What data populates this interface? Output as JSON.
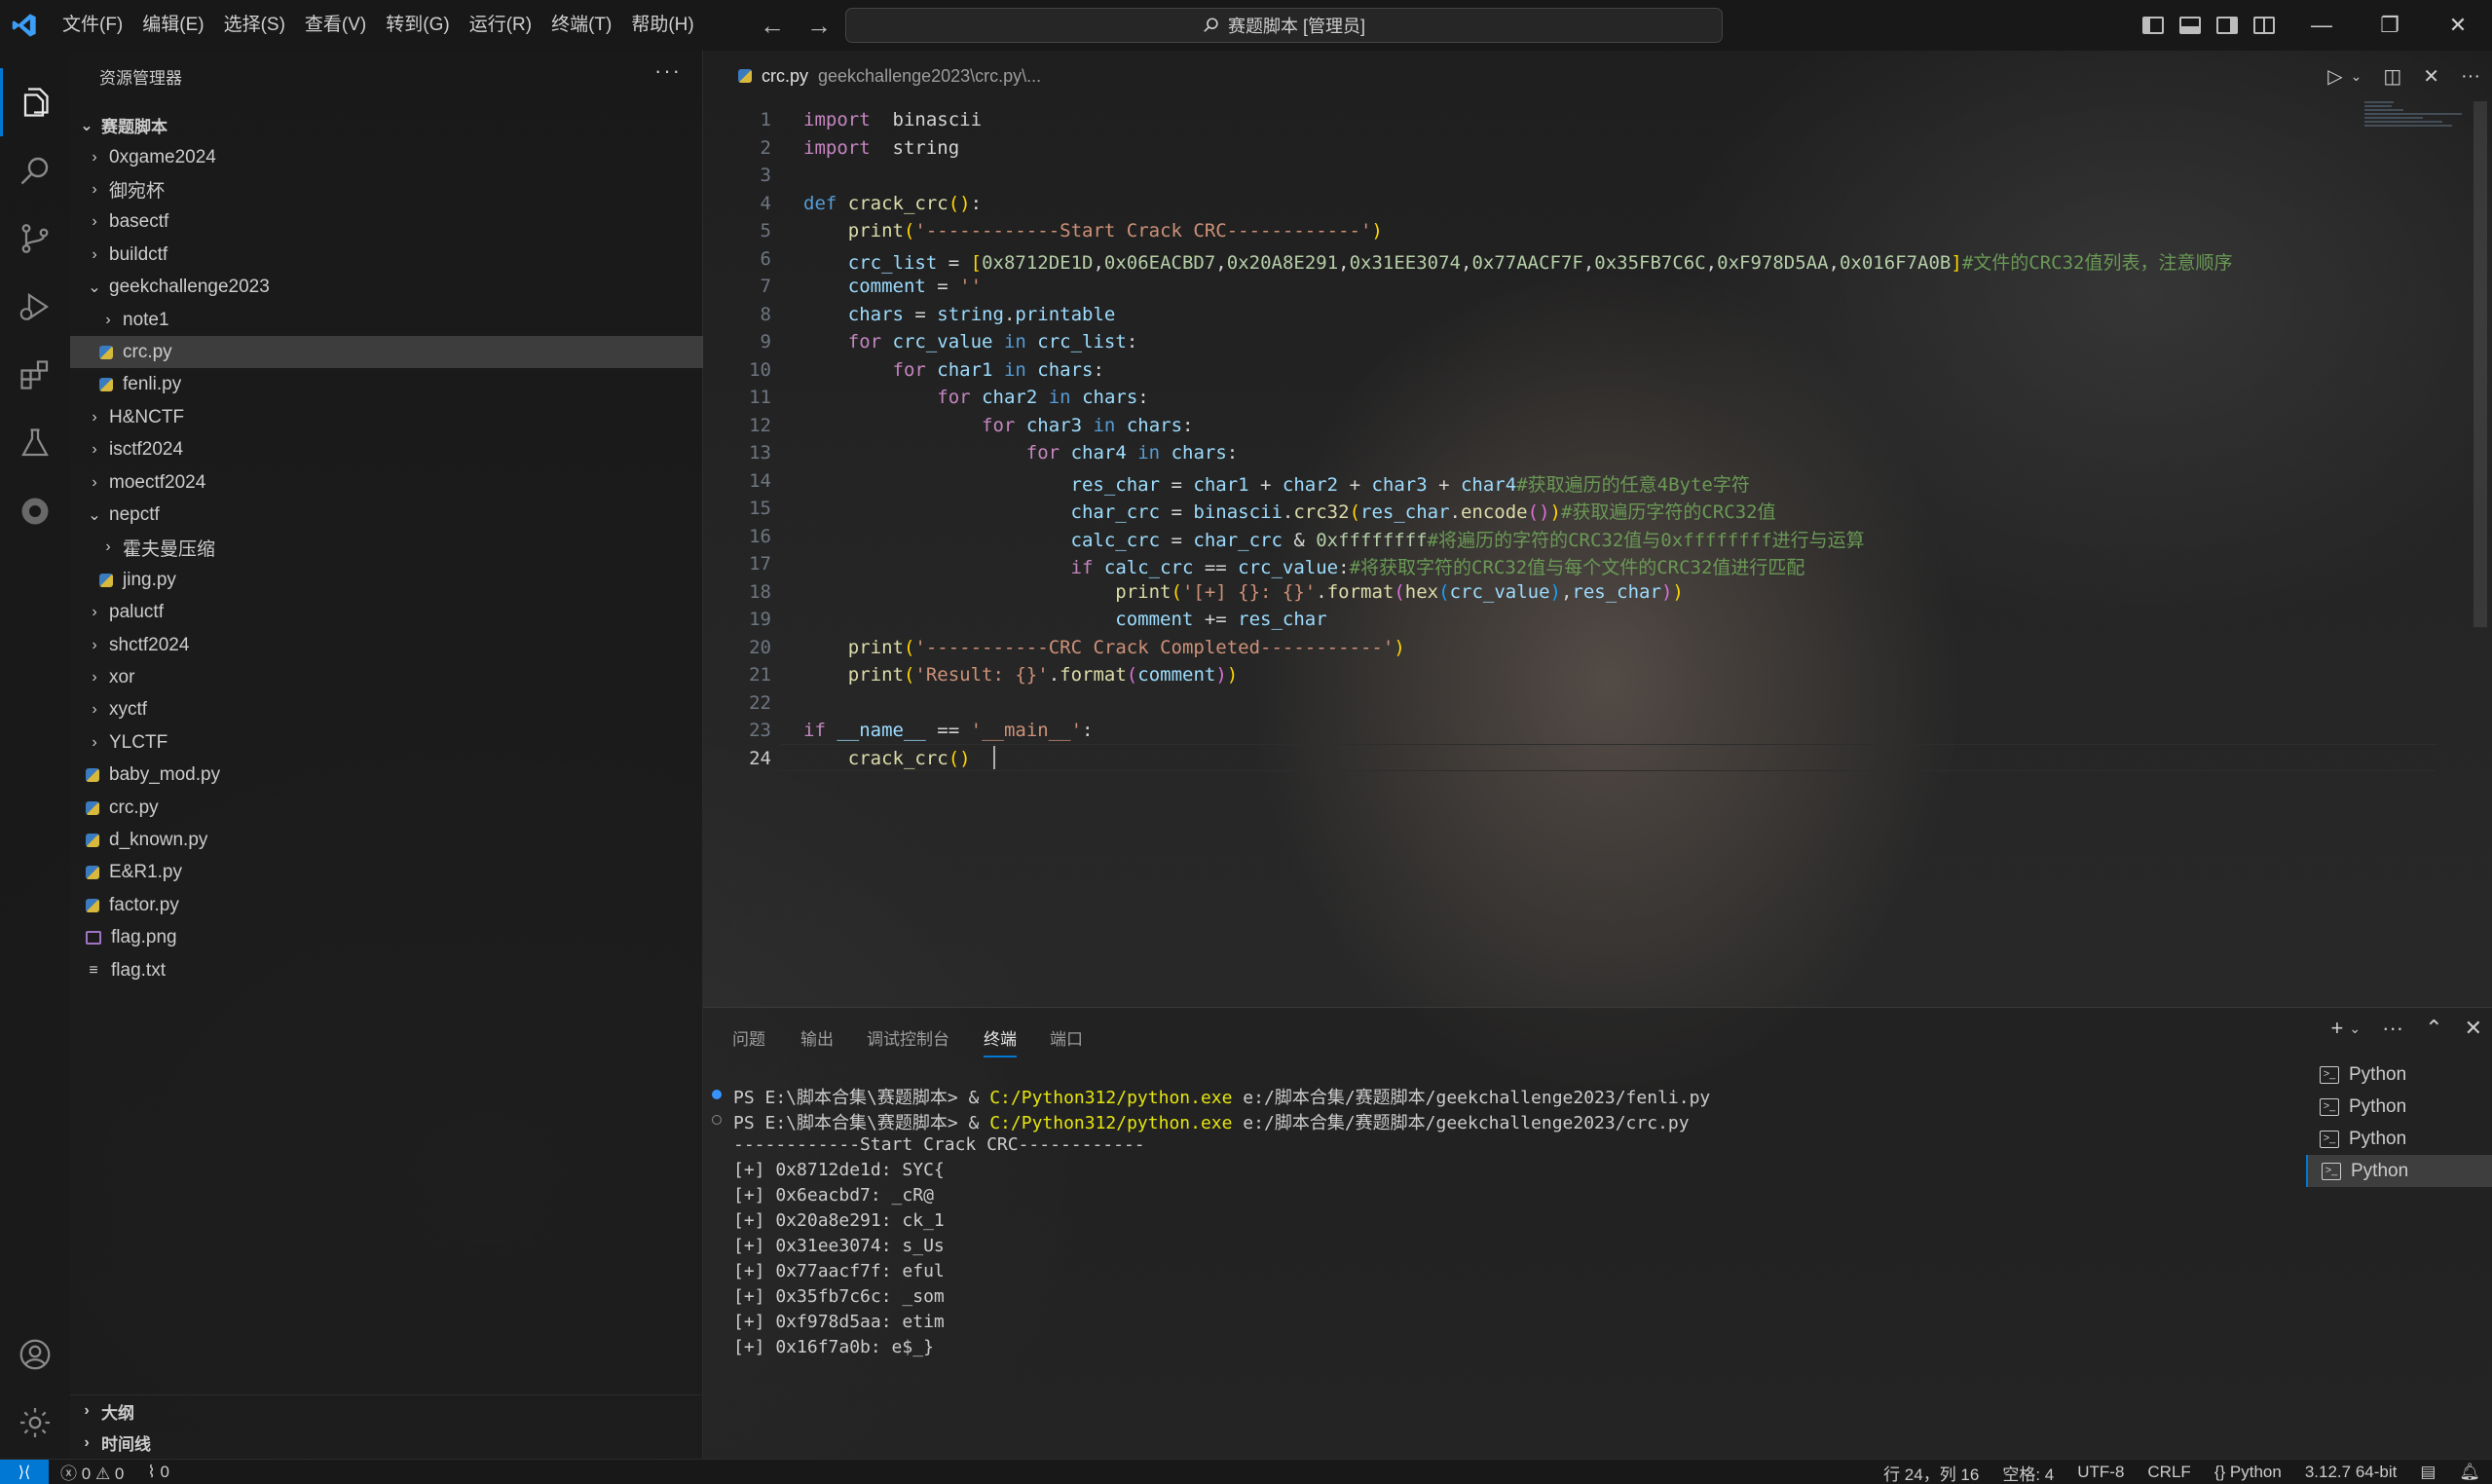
{
  "menu": [
    "文件(F)",
    "编辑(E)",
    "选择(S)",
    "查看(V)",
    "转到(G)",
    "运行(R)",
    "终端(T)",
    "帮助(H)"
  ],
  "command_center": "赛题脚本 [管理员]",
  "sidebar": {
    "title": "资源管理器",
    "more": "···",
    "root": "赛题脚本",
    "items": [
      {
        "label": "0xgame2024",
        "type": "folder",
        "open": false,
        "depth": 0
      },
      {
        "label": "御宛杯",
        "type": "folder",
        "open": false,
        "depth": 0
      },
      {
        "label": "basectf",
        "type": "folder",
        "open": false,
        "depth": 0
      },
      {
        "label": "buildctf",
        "type": "folder",
        "open": false,
        "depth": 0
      },
      {
        "label": "geekchallenge2023",
        "type": "folder",
        "open": true,
        "depth": 0
      },
      {
        "label": "note1",
        "type": "folder",
        "open": false,
        "depth": 1
      },
      {
        "label": "crc.py",
        "type": "py",
        "depth": 1,
        "selected": true
      },
      {
        "label": "fenli.py",
        "type": "py",
        "depth": 1
      },
      {
        "label": "H&NCTF",
        "type": "folder",
        "open": false,
        "depth": 0
      },
      {
        "label": "isctf2024",
        "type": "folder",
        "open": false,
        "depth": 0
      },
      {
        "label": "moectf2024",
        "type": "folder",
        "open": false,
        "depth": 0
      },
      {
        "label": "nepctf",
        "type": "folder",
        "open": true,
        "depth": 0
      },
      {
        "label": "霍夫曼压缩",
        "type": "folder",
        "open": false,
        "depth": 1
      },
      {
        "label": "jing.py",
        "type": "py",
        "depth": 1
      },
      {
        "label": "paluctf",
        "type": "folder",
        "open": false,
        "depth": 0
      },
      {
        "label": "shctf2024",
        "type": "folder",
        "open": false,
        "depth": 0
      },
      {
        "label": "xor",
        "type": "folder",
        "open": false,
        "depth": 0
      },
      {
        "label": "xyctf",
        "type": "folder",
        "open": false,
        "depth": 0
      },
      {
        "label": "YLCTF",
        "type": "folder",
        "open": false,
        "depth": 0
      },
      {
        "label": "baby_mod.py",
        "type": "py",
        "depth": 0
      },
      {
        "label": "crc.py",
        "type": "py",
        "depth": 0
      },
      {
        "label": "d_known.py",
        "type": "py",
        "depth": 0
      },
      {
        "label": "E&R1.py",
        "type": "py",
        "depth": 0
      },
      {
        "label": "factor.py",
        "type": "py",
        "depth": 0
      },
      {
        "label": "flag.png",
        "type": "png",
        "depth": 0
      },
      {
        "label": "flag.txt",
        "type": "txt",
        "depth": 0
      }
    ],
    "outline": "大纲",
    "timeline": "时间线"
  },
  "editor": {
    "tab_name": "crc.py",
    "tab_path": "geekchallenge2023\\crc.py\\...",
    "current_line": 24,
    "lines": [
      [
        [
          "kw2",
          "import"
        ],
        [
          "",
          "  "
        ],
        [
          "",
          "binascii"
        ]
      ],
      [
        [
          "kw2",
          "import"
        ],
        [
          "",
          "  "
        ],
        [
          "",
          "string"
        ]
      ],
      [],
      [
        [
          "kw",
          "def"
        ],
        [
          "",
          " "
        ],
        [
          "fn",
          "crack_crc"
        ],
        [
          "br1",
          "()"
        ],
        [
          "",
          ":"
        ]
      ],
      [
        [
          "",
          "    "
        ],
        [
          "fn",
          "print"
        ],
        [
          "br1",
          "("
        ],
        [
          "str",
          "'------------Start Crack CRC------------'"
        ],
        [
          "br1",
          ")"
        ]
      ],
      [
        [
          "",
          "    "
        ],
        [
          "var",
          "crc_list"
        ],
        [
          "",
          " = "
        ],
        [
          "br1",
          "["
        ],
        [
          "num",
          "0x8712DE1D"
        ],
        [
          "",
          ","
        ],
        [
          "num",
          "0x06EACBD7"
        ],
        [
          "",
          ","
        ],
        [
          "num",
          "0x20A8E291"
        ],
        [
          "",
          ","
        ],
        [
          "num",
          "0x31EE3074"
        ],
        [
          "",
          ","
        ],
        [
          "num",
          "0x77AACF7F"
        ],
        [
          "",
          ","
        ],
        [
          "num",
          "0x35FB7C6C"
        ],
        [
          "",
          ","
        ],
        [
          "num",
          "0xF978D5AA"
        ],
        [
          "",
          ","
        ],
        [
          "num",
          "0x016F7A0B"
        ],
        [
          "br1",
          "]"
        ],
        [
          "cm",
          "#文件的CRC32值列表，注意顺序"
        ]
      ],
      [
        [
          "",
          "    "
        ],
        [
          "var",
          "comment"
        ],
        [
          "",
          " = "
        ],
        [
          "str",
          "''"
        ]
      ],
      [
        [
          "",
          "    "
        ],
        [
          "var",
          "chars"
        ],
        [
          "",
          " = "
        ],
        [
          "var",
          "string"
        ],
        [
          "",
          "."
        ],
        [
          "var",
          "printable"
        ]
      ],
      [
        [
          "",
          "    "
        ],
        [
          "kw2",
          "for"
        ],
        [
          "",
          " "
        ],
        [
          "var",
          "crc_value"
        ],
        [
          "",
          " "
        ],
        [
          "kw",
          "in"
        ],
        [
          "",
          " "
        ],
        [
          "var",
          "crc_list"
        ],
        [
          "",
          ":"
        ]
      ],
      [
        [
          "",
          "        "
        ],
        [
          "kw2",
          "for"
        ],
        [
          "",
          " "
        ],
        [
          "var",
          "char1"
        ],
        [
          "",
          " "
        ],
        [
          "kw",
          "in"
        ],
        [
          "",
          " "
        ],
        [
          "var",
          "chars"
        ],
        [
          "",
          ":"
        ]
      ],
      [
        [
          "",
          "            "
        ],
        [
          "kw2",
          "for"
        ],
        [
          "",
          " "
        ],
        [
          "var",
          "char2"
        ],
        [
          "",
          " "
        ],
        [
          "kw",
          "in"
        ],
        [
          "",
          " "
        ],
        [
          "var",
          "chars"
        ],
        [
          "",
          ":"
        ]
      ],
      [
        [
          "",
          "                "
        ],
        [
          "kw2",
          "for"
        ],
        [
          "",
          " "
        ],
        [
          "var",
          "char3"
        ],
        [
          "",
          " "
        ],
        [
          "kw",
          "in"
        ],
        [
          "",
          " "
        ],
        [
          "var",
          "chars"
        ],
        [
          "",
          ":"
        ]
      ],
      [
        [
          "",
          "                    "
        ],
        [
          "kw2",
          "for"
        ],
        [
          "",
          " "
        ],
        [
          "var",
          "char4"
        ],
        [
          "",
          " "
        ],
        [
          "kw",
          "in"
        ],
        [
          "",
          " "
        ],
        [
          "var",
          "chars"
        ],
        [
          "",
          ":"
        ]
      ],
      [
        [
          "",
          "                        "
        ],
        [
          "var",
          "res_char"
        ],
        [
          "",
          " = "
        ],
        [
          "var",
          "char1"
        ],
        [
          "",
          " + "
        ],
        [
          "var",
          "char2"
        ],
        [
          "",
          " + "
        ],
        [
          "var",
          "char3"
        ],
        [
          "",
          " + "
        ],
        [
          "var",
          "char4"
        ],
        [
          "cm",
          "#获取遍历的任意4Byte字符"
        ]
      ],
      [
        [
          "",
          "                        "
        ],
        [
          "var",
          "char_crc"
        ],
        [
          "",
          " = "
        ],
        [
          "var",
          "binascii"
        ],
        [
          "",
          "."
        ],
        [
          "fn",
          "crc32"
        ],
        [
          "br1",
          "("
        ],
        [
          "var",
          "res_char"
        ],
        [
          "",
          "."
        ],
        [
          "fn",
          "encode"
        ],
        [
          "br2",
          "()"
        ],
        [
          "br1",
          ")"
        ],
        [
          "cm",
          "#获取遍历字符的CRC32值"
        ]
      ],
      [
        [
          "",
          "                        "
        ],
        [
          "var",
          "calc_crc"
        ],
        [
          "",
          " = "
        ],
        [
          "var",
          "char_crc"
        ],
        [
          "",
          " & "
        ],
        [
          "num",
          "0xffffffff"
        ],
        [
          "cm",
          "#将遍历的字符的CRC32值与0xffffffff进行与运算"
        ]
      ],
      [
        [
          "",
          "                        "
        ],
        [
          "kw2",
          "if"
        ],
        [
          "",
          " "
        ],
        [
          "var",
          "calc_crc"
        ],
        [
          "",
          " == "
        ],
        [
          "var",
          "crc_value"
        ],
        [
          "",
          ":"
        ],
        [
          "cm",
          "#将获取字符的CRC32值与每个文件的CRC32值进行匹配"
        ]
      ],
      [
        [
          "",
          "                            "
        ],
        [
          "fn",
          "print"
        ],
        [
          "br1",
          "("
        ],
        [
          "str",
          "'[+] {}: {}'"
        ],
        [
          "",
          "."
        ],
        [
          "fn",
          "format"
        ],
        [
          "br2",
          "("
        ],
        [
          "fn",
          "hex"
        ],
        [
          "br3",
          "("
        ],
        [
          "var",
          "crc_value"
        ],
        [
          "br3",
          ")"
        ],
        [
          "",
          ","
        ],
        [
          "var",
          "res_char"
        ],
        [
          "br2",
          ")"
        ],
        [
          "br1",
          ")"
        ]
      ],
      [
        [
          "",
          "                            "
        ],
        [
          "var",
          "comment"
        ],
        [
          "",
          " += "
        ],
        [
          "var",
          "res_char"
        ]
      ],
      [
        [
          "",
          "    "
        ],
        [
          "fn",
          "print"
        ],
        [
          "br1",
          "("
        ],
        [
          "str",
          "'-----------CRC Crack Completed-----------'"
        ],
        [
          "br1",
          ")"
        ]
      ],
      [
        [
          "",
          "    "
        ],
        [
          "fn",
          "print"
        ],
        [
          "br1",
          "("
        ],
        [
          "str",
          "'Result: {}'"
        ],
        [
          "",
          "."
        ],
        [
          "fn",
          "format"
        ],
        [
          "br2",
          "("
        ],
        [
          "var",
          "comment"
        ],
        [
          "br2",
          ")"
        ],
        [
          "br1",
          ")"
        ]
      ],
      [],
      [
        [
          "kw2",
          "if"
        ],
        [
          "",
          " "
        ],
        [
          "var",
          "__name__"
        ],
        [
          "",
          " == "
        ],
        [
          "str",
          "'__main__'"
        ],
        [
          "",
          ":"
        ]
      ],
      [
        [
          "",
          "    "
        ],
        [
          "fn",
          "crack_crc"
        ],
        [
          "br1",
          "()"
        ]
      ]
    ]
  },
  "panel": {
    "tabs": [
      "问题",
      "输出",
      "调试控制台",
      "终端",
      "端口"
    ],
    "active_tab": "终端",
    "terminal_lines": [
      {
        "prefix": "PS E:\\脚本合集\\赛题脚本> & ",
        "exe": "C:/Python312/python.exe",
        "rest": " e:/脚本合集/赛题脚本/geekchallenge2023/fenli.py",
        "dot": "blue"
      },
      {
        "prefix": "PS E:\\脚本合集\\赛题脚本> & ",
        "exe": "C:/Python312/python.exe",
        "rest": " e:/脚本合集/赛题脚本/geekchallenge2023/crc.py",
        "dot": "hollow"
      },
      {
        "text": "------------Start Crack CRC------------"
      },
      {
        "text": "[+] 0x8712de1d: SYC{"
      },
      {
        "text": "[+] 0x6eacbd7: _cR@"
      },
      {
        "text": "[+] 0x20a8e291: ck_1"
      },
      {
        "text": "[+] 0x31ee3074: s_Us"
      },
      {
        "text": "[+] 0x77aacf7f: eful"
      },
      {
        "text": "[+] 0x35fb7c6c: _som"
      },
      {
        "text": "[+] 0xf978d5aa: etim"
      },
      {
        "text": "[+] 0x16f7a0b: e$_}"
      }
    ],
    "terminals": [
      "Python",
      "Python",
      "Python",
      "Python"
    ],
    "selected_terminal": 3
  },
  "statusbar": {
    "errors": "0",
    "warnings": "0",
    "ports": "0",
    "position": "行 24，列 16",
    "spaces": "空格: 4",
    "encoding": "UTF-8",
    "eol": "CRLF",
    "language": "{} Python",
    "interpreter": "3.12.7 64-bit"
  }
}
